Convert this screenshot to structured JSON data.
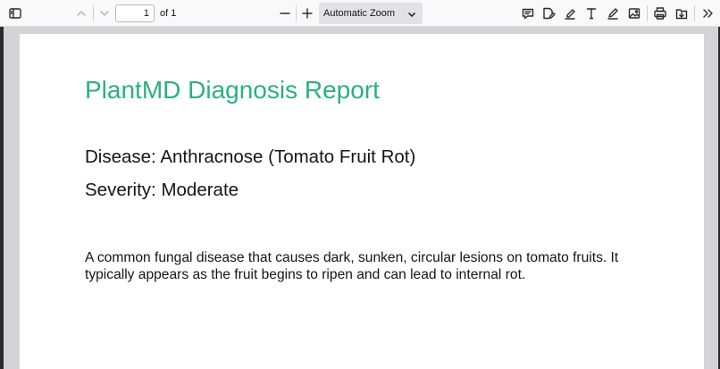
{
  "toolbar": {
    "page_number": "1",
    "page_count_label": "of 1",
    "zoom_label": "Automatic Zoom",
    "icons": {
      "sidebar": "sidebar-toggle-icon",
      "previous": "chevron-up-icon",
      "next": "chevron-down-icon",
      "zoom_out": "minus-icon",
      "zoom_in": "plus-icon",
      "comment": "comment-icon",
      "signature": "signature-icon",
      "highlight": "highlight-icon",
      "text": "text-icon",
      "draw": "pencil-icon",
      "image": "image-icon",
      "print": "printer-icon",
      "save": "save-icon",
      "more": "double-chevron-right-icon"
    }
  },
  "document": {
    "title": "PlantMD Diagnosis Report",
    "disease": "Disease: Anthracnose (Tomato Fruit Rot)",
    "severity": "Severity: Moderate",
    "description": "A common fungal disease that causes dark, sunken, circular lesions on tomato fruits. It typically appears as the fruit begins to ripen and can lead to internal rot."
  },
  "colors": {
    "title_accent": "#2bb07f",
    "toolbar_bg": "#f9f9fa",
    "viewer_bg": "#d4d4d7"
  }
}
